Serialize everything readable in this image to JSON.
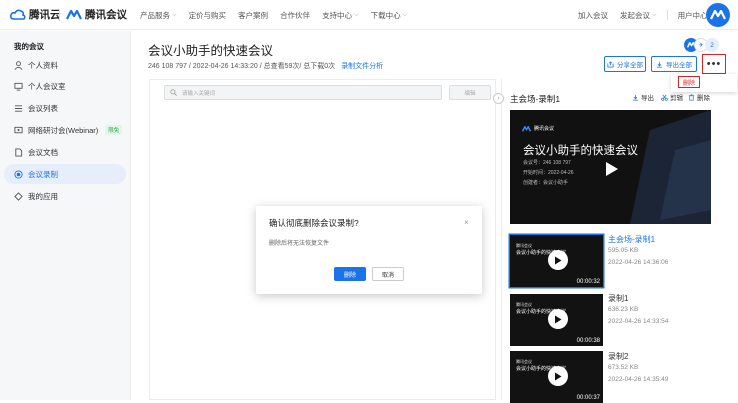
{
  "header": {
    "brand_cloud": "腾讯云",
    "brand_meeting": "腾讯会议",
    "nav": [
      "产品服务",
      "定价与购买",
      "客户案例",
      "合作伙伴",
      "支持中心",
      "下载中心"
    ],
    "join": "加入会议",
    "start": "发起会议",
    "user_center": "用户中心"
  },
  "sidebar": {
    "title": "我的会议",
    "items": [
      {
        "label": "个人资料",
        "icon": "person-icon"
      },
      {
        "label": "个人会议室",
        "icon": "monitor-icon"
      },
      {
        "label": "会议列表",
        "icon": "list-icon"
      },
      {
        "label": "网络研讨会(Webinar)",
        "icon": "webinar-icon",
        "badge": "限免"
      },
      {
        "label": "会议文档",
        "icon": "document-icon"
      },
      {
        "label": "会议录制",
        "icon": "record-icon"
      },
      {
        "label": "我的应用",
        "icon": "apps-icon"
      }
    ]
  },
  "meeting": {
    "title": "会议小助手的快速会议",
    "id": "246 108 797",
    "meta": " / 2022-04-26 14:33:20  / 总查看59次/ 总下载0次",
    "transcript_link": "录制文件分析",
    "avatar_count": "2"
  },
  "toolbar": {
    "share_all": "分享全部",
    "export_all": "导出全部",
    "more": "•••",
    "delete": "删除"
  },
  "search": {
    "placeholder": "请输入关键词",
    "edit": "编辑"
  },
  "recording": {
    "panel_title": "主会场-录制1",
    "actions": [
      "导出",
      "剪辑",
      "删除"
    ],
    "preview": {
      "logo": "腾讯会议",
      "title": "会议小助手的快速会议",
      "info": [
        "会议号：246 108 797",
        "开始时间：2022-04-26",
        "创建者：会议小助手"
      ]
    },
    "items": [
      {
        "name": "主会场-录制1",
        "size": "595.05 KB",
        "time": "2022-04-26 14:36:06",
        "duration": "00:00:32",
        "thumb_title": "会议小助手的快速会议"
      },
      {
        "name": "录制1",
        "size": "636.23 KB",
        "time": "2022-04-26 14:33:54",
        "duration": "00:00:38",
        "thumb_title": "会议小助手的快速会议"
      },
      {
        "name": "录制2",
        "size": "673.52 KB",
        "time": "2022-04-26 14:35:49",
        "duration": "00:00:37",
        "thumb_title": "会议小助手的快速会议"
      }
    ]
  },
  "dialog": {
    "title": "确认彻底删除会议录制?",
    "body": "删除后将无法恢复文件",
    "ok": "删除",
    "cancel": "取消",
    "close": "×"
  },
  "colors": {
    "accent": "#1a73e8",
    "danger": "#e02020"
  }
}
